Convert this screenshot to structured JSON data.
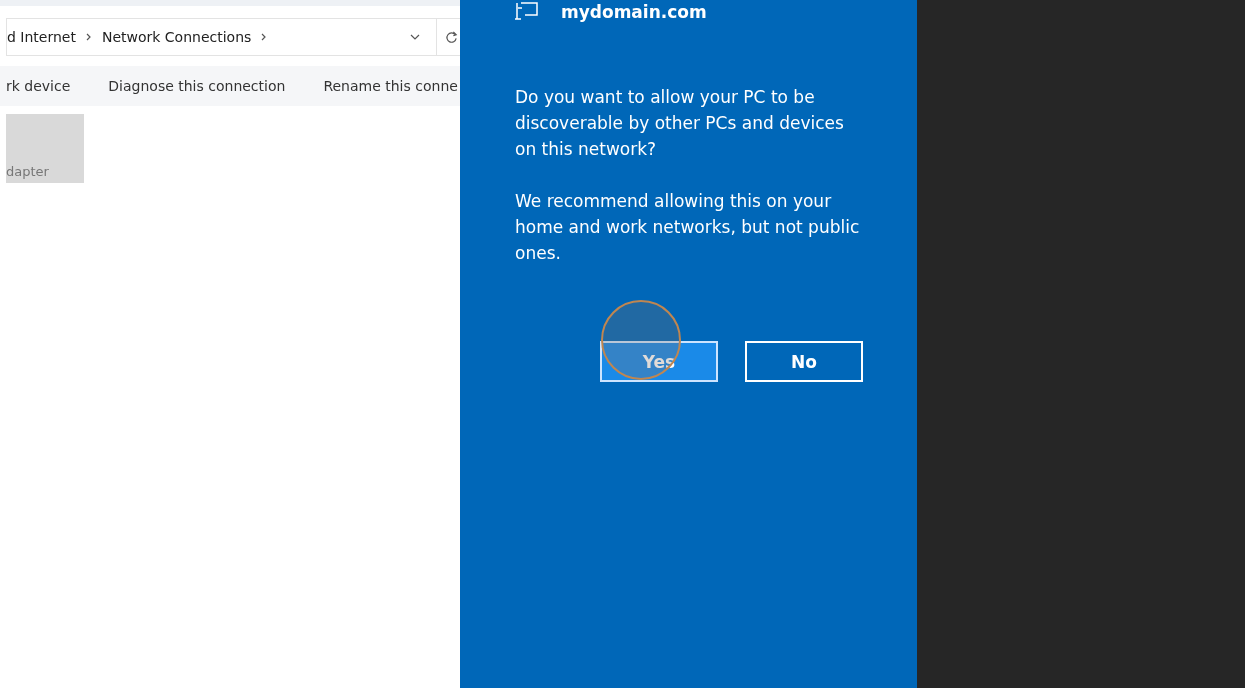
{
  "explorer": {
    "breadcrumb": [
      "d Internet",
      "Network Connections"
    ],
    "toolbar": [
      "rk device",
      "Diagnose this connection",
      "Rename this conne"
    ],
    "adapter": {
      "label": "dapter",
      "selected": true
    }
  },
  "flyout": {
    "network": "mydomain.com",
    "paragraphs": [
      "Do you want to allow your PC to be discoverable by other PCs and devices on this network?",
      "We recommend allowing this on your home and work networks, but not public ones."
    ],
    "buttons": [
      {
        "label": "Yes",
        "selected": true
      },
      {
        "label": "No",
        "selected": false
      }
    ]
  }
}
